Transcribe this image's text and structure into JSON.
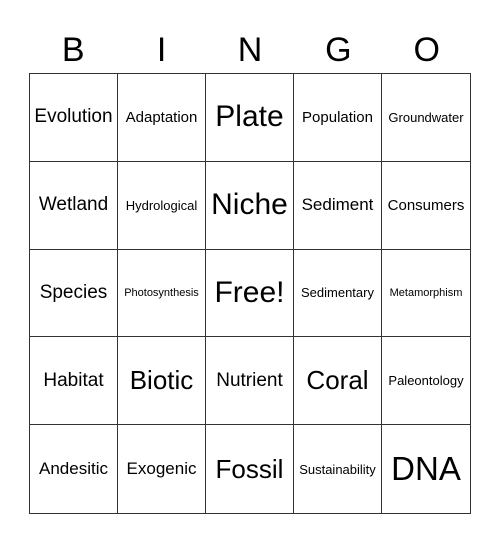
{
  "header": {
    "letters": [
      "B",
      "I",
      "N",
      "G",
      "O"
    ]
  },
  "grid": {
    "rows": [
      [
        "Evolution",
        "Adaptation",
        "Plate",
        "Population",
        "Groundwater"
      ],
      [
        "Wetland",
        "Hydrological",
        "Niche",
        "Sediment",
        "Consumers"
      ],
      [
        "Species",
        "Photosynthesis",
        "Free!",
        "Sedimentary",
        "Metamorphism"
      ],
      [
        "Habitat",
        "Biotic",
        "Nutrient",
        "Coral",
        "Paleontology"
      ],
      [
        "Andesitic",
        "Exogenic",
        "Fossil",
        "Sustainability",
        "DNA"
      ]
    ]
  },
  "colors": {
    "background": "#ffffff",
    "text": "#000000",
    "border": "#333333"
  }
}
